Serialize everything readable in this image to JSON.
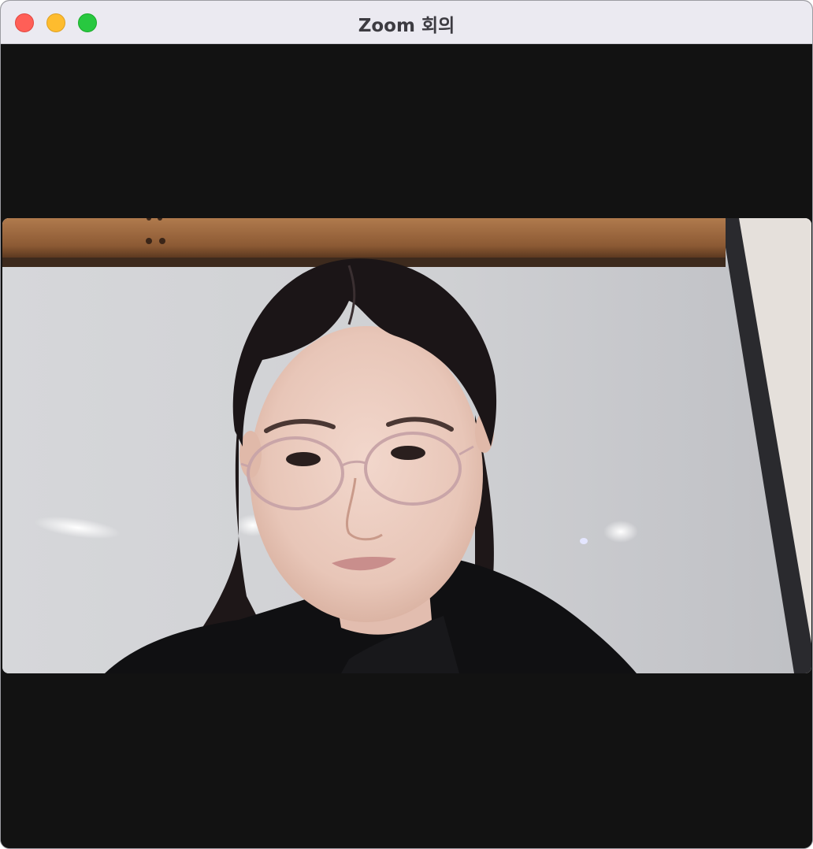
{
  "window": {
    "title": "Zoom 회의"
  },
  "controls": {
    "close": "close",
    "minimize": "minimize",
    "zoom": "zoom"
  },
  "video": {
    "participant_feed": "webcam-video"
  },
  "colors": {
    "titlebar": "#ebeaf1",
    "background": "#121212",
    "close": "#ff5f57",
    "minimize": "#febc2e",
    "zoom": "#28c840"
  }
}
